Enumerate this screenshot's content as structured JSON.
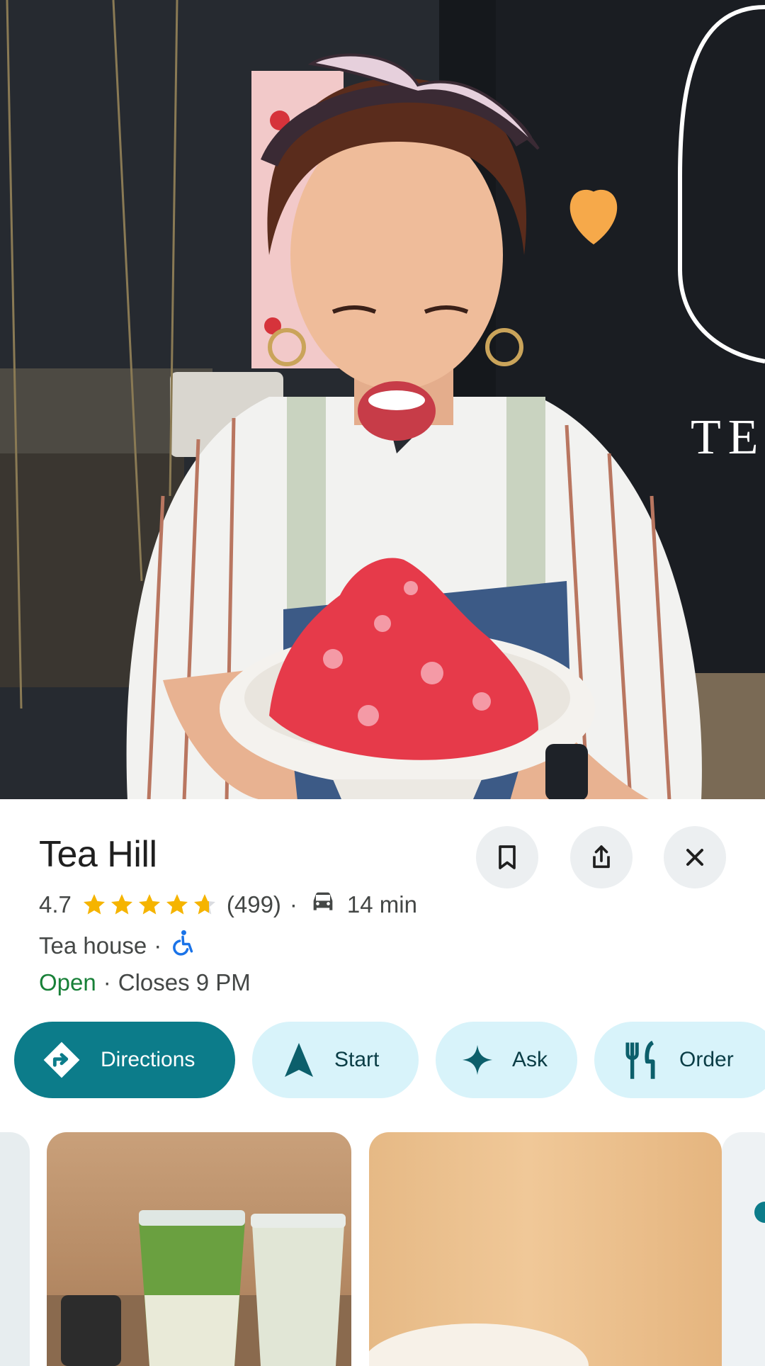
{
  "place": {
    "name": "Tea Hill",
    "rating": "4.7",
    "rating_value": 4.7,
    "reviews": "(499)",
    "drive_time": "14 min",
    "category": "Tea house",
    "open_status": "Open",
    "closes": "Closes 9 PM",
    "separator": "·"
  },
  "icons": {
    "save": "bookmark-icon",
    "share": "share-icon",
    "close": "close-icon",
    "car": "car-icon",
    "accessible": "wheelchair-icon"
  },
  "actions": [
    {
      "label": "Directions",
      "icon": "directions-icon"
    },
    {
      "label": "Start",
      "icon": "navigation-arrow-icon"
    },
    {
      "label": "Ask",
      "icon": "sparkle-icon"
    },
    {
      "label": "Order",
      "icon": "fork-knife-icon"
    }
  ],
  "colors": {
    "primary_chip": "#0c7c8a",
    "chip_bg": "#d8f3fa",
    "star": "#f5b400",
    "open": "#188038",
    "accessible_icon": "#1a73e8"
  }
}
